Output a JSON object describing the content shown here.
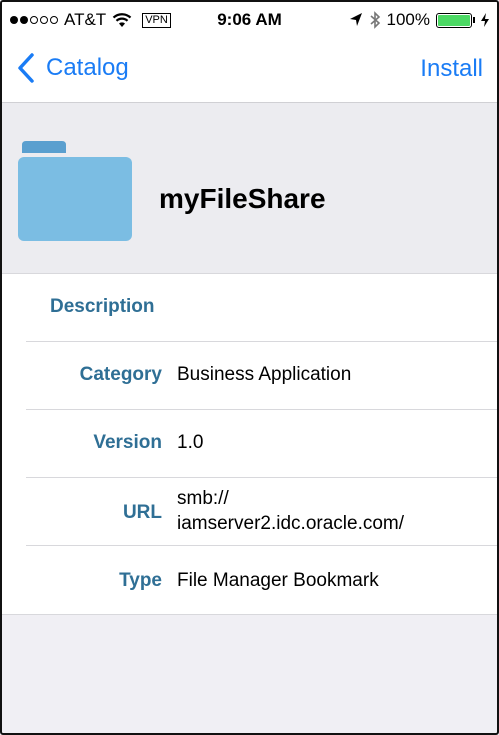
{
  "status_bar": {
    "signal_dots": [
      "full",
      "full",
      "empty",
      "empty",
      "empty"
    ],
    "carrier": "AT&T",
    "vpn": "VPN",
    "time": "9:06 AM",
    "battery": "100%",
    "battery_level": 1.0
  },
  "nav": {
    "back_label": "Catalog",
    "action_label": "Install"
  },
  "app": {
    "name": "myFileShare",
    "icon": "folder-icon"
  },
  "details": {
    "description_label": "Description",
    "category_label": "Category",
    "category_value": "Business Application",
    "version_label": "Version",
    "version_value": "1.0",
    "url_label": "URL",
    "url_line1": "smb://",
    "url_line2": "iamserver2.idc.oracle.com/",
    "type_label": "Type",
    "type_value": "File Manager Bookmark"
  },
  "colors": {
    "accent": "#1a7cf5",
    "label": "#2f6f95",
    "folder": "#7bbde3",
    "battery": "#4cd964"
  }
}
